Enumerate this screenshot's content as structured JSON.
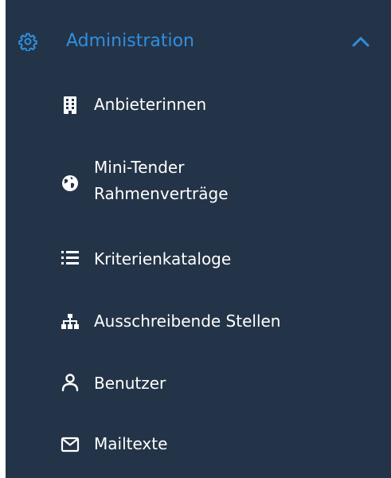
{
  "sidebar": {
    "group": {
      "label": "Administration",
      "icon": "gear-icon",
      "expanded": true,
      "accent_color": "#2f8fe0"
    },
    "items": [
      {
        "label": "Anbieterinnen",
        "icon": "building-icon"
      },
      {
        "label": "Mini-Tender\nRahmenverträge",
        "icon": "globe-icon"
      },
      {
        "label": "Kriterienkataloge",
        "icon": "list-icon"
      },
      {
        "label": "Ausschreibende Stellen",
        "icon": "sitemap-icon"
      },
      {
        "label": "Benutzer",
        "icon": "user-icon"
      },
      {
        "label": "Mailtexte",
        "icon": "envelope-icon"
      }
    ],
    "background_color": "#243448",
    "text_color": "#ffffff"
  }
}
